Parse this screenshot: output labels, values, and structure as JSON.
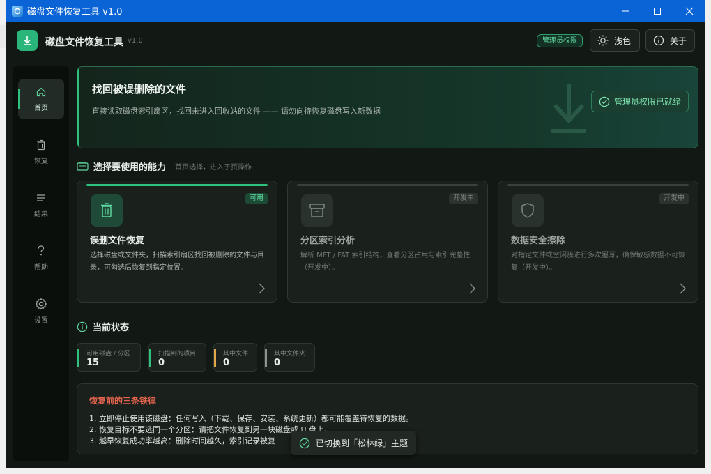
{
  "window": {
    "title": "磁盘文件恢复工具 v1.0",
    "controls": {
      "minimize": "—",
      "maximize": "☐",
      "close": "✕"
    }
  },
  "header": {
    "app_name": "磁盘文件恢复工具",
    "version": "v1.0",
    "admin_badge": "管理员权限",
    "theme_button": "浅色",
    "about_button": "关于"
  },
  "sidebar": {
    "items": [
      {
        "label": "首页",
        "icon": "home-icon",
        "active": true
      },
      {
        "label": "恢复",
        "icon": "trash-icon",
        "active": false
      },
      {
        "label": "结果",
        "icon": "list-icon",
        "active": false
      },
      {
        "label": "帮助",
        "icon": "help-icon",
        "active": false
      },
      {
        "label": "设置",
        "icon": "gear-icon",
        "active": false
      }
    ]
  },
  "hero": {
    "title": "找回被误删除的文件",
    "description": "直接读取磁盘索引扇区，找回未进入回收站的文件 —— 请勿向待恢复磁盘写入新数据",
    "status": "管理员权限已就绪"
  },
  "capabilities": {
    "title": "选择要使用的能力",
    "subtitle": "首页选择，进入子页操作",
    "cards": [
      {
        "title": "误删文件恢复",
        "tag": "可用",
        "icon": "trash-icon",
        "enabled": true,
        "description": "选择磁盘或文件夹，扫描索引扇区找回被删除的文件与目录，可勾选后恢复到指定位置。"
      },
      {
        "title": "分区索引分析",
        "tag": "开发中",
        "icon": "archive-icon",
        "enabled": false,
        "description": "解析 MFT / FAT 索引结构，查看分区占用与索引完整性（开发中）。"
      },
      {
        "title": "数据安全擦除",
        "tag": "开发中",
        "icon": "shield-icon",
        "enabled": false,
        "description": "对指定文件或空闲簇进行多次覆写，确保敏感数据不可恢复（开发中）。"
      }
    ]
  },
  "status": {
    "title": "当前状态",
    "stats": [
      {
        "label": "可用磁盘 / 分区",
        "value": "15",
        "color": "#2ec27e"
      },
      {
        "label": "扫描到的项目",
        "value": "0",
        "color": "#2ec27e"
      },
      {
        "label": "其中文件",
        "value": "0",
        "color": "#e0a84a"
      },
      {
        "label": "其中文件夹",
        "value": "0",
        "color": "#8c968f"
      }
    ]
  },
  "rules": {
    "title": "恢复前的三条铁律",
    "items": [
      "1. 立即停止使用该磁盘：任何写入（下载、保存、安装、系统更新）都可能覆盖待恢复的数据。",
      "2. 恢复目标不要选同一个分区：请把文件恢复到另一块磁盘或 U 盘上。",
      "3. 越早恢复成功率越高：删除时间越久，索引记录被复"
    ]
  },
  "toast": {
    "message": "已切换到「松林绿」主题"
  },
  "colors": {
    "accent": "#2ec27e",
    "warning": "#e0a84a",
    "danger": "#e8654f",
    "titlebar": "#0a64d6"
  }
}
